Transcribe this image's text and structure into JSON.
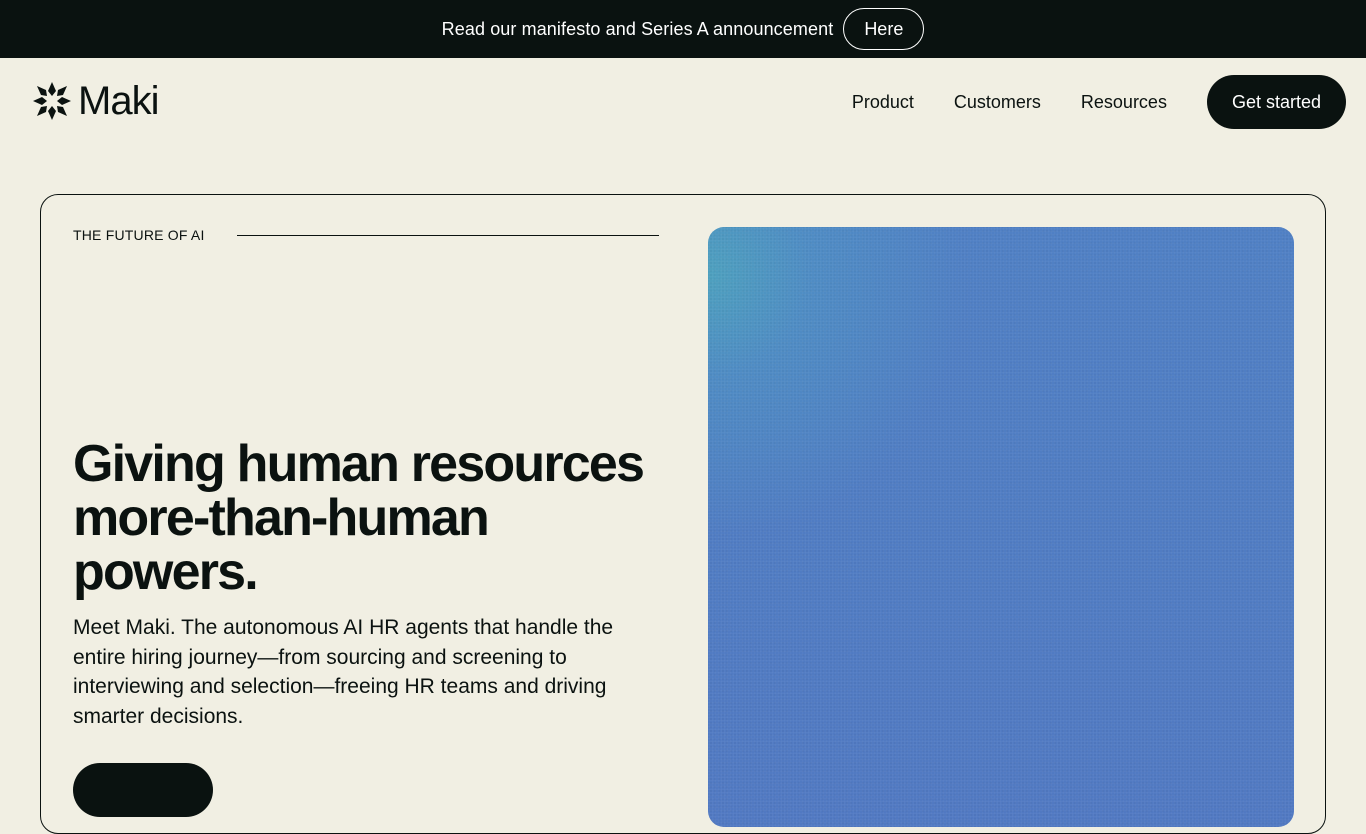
{
  "announcement": {
    "text": "Read our manifesto and Series A announcement",
    "button_label": "Here"
  },
  "header": {
    "logo_text": "Maki",
    "nav": [
      {
        "label": "Product"
      },
      {
        "label": "Customers"
      },
      {
        "label": "Resources"
      }
    ],
    "cta_label": "Get started"
  },
  "hero": {
    "eyebrow": "THE FUTURE OF AI",
    "headline": "Giving human resources more-than-human powers.",
    "subcopy": "Meet Maki. The autonomous AI HR agents that handle the entire hiring journey—from sourcing and screening to interviewing and selection—freeing HR teams and driving smarter decisions."
  },
  "colors": {
    "background": "#f1efe3",
    "dark": "#0a1210",
    "visual_blue": "#5179c2",
    "visual_teal": "#4ea2be"
  },
  "icons": {
    "logo": "maki-star-logo-icon"
  }
}
